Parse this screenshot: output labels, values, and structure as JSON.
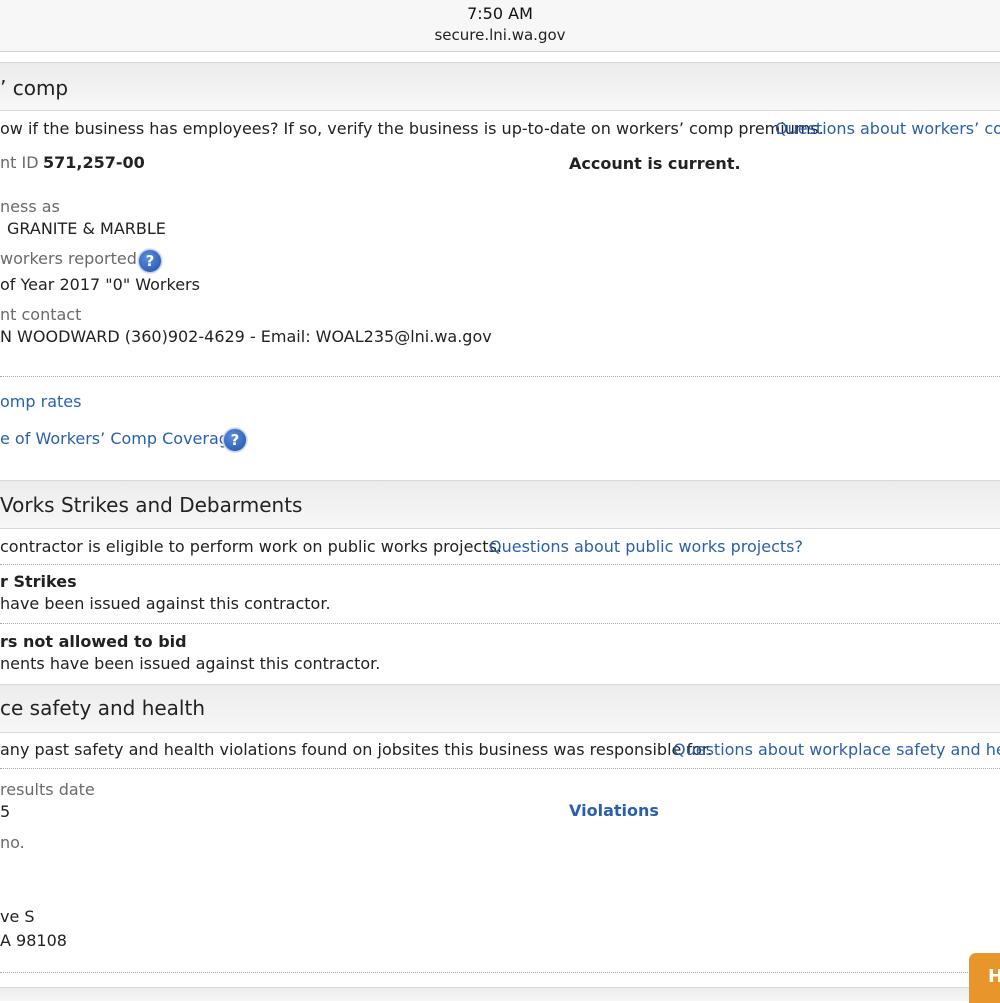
{
  "status_bar": {
    "time": "7:50 AM",
    "url": "secure.lni.wa.gov"
  },
  "workers_comp": {
    "title": "’ comp",
    "intro_text": "ow if the business has employees? If so, verify the business is up-to-date on workers’ comp premiums.",
    "intro_link": "Questions about workers’ com",
    "account_id_label": "nt ID",
    "account_id_value": "571,257-00",
    "account_status": "Account is current.",
    "dba_label": "ness as",
    "dba_value": "GRANITE & MARBLE",
    "workers_label": "workers reported",
    "workers_value": "of Year 2017 \"0\" Workers",
    "contact_label": "nt contact",
    "contact_value": "N WOODWARD (360)902-4629 - Email: WOAL235@lni.wa.gov",
    "rates_link": "omp rates",
    "coverage_link": "e of Workers’ Comp Coverage",
    "help_glyph": "?"
  },
  "public_works": {
    "title": "Vorks Strikes and Debarments",
    "intro_text": "contractor is eligible to perform work on public works projects.",
    "intro_link": "Questions about public works projects?",
    "strikes_label": "r Strikes",
    "strikes_value": "have been issued against this contractor.",
    "bid_label": "rs not allowed to bid",
    "bid_value": "nents have been issued against this contractor."
  },
  "safety": {
    "title": "ce safety and health",
    "intro_text": "any past safety and health violations found on jobsites this business was responsible for.",
    "intro_link": "Questions about workplace safety and heal",
    "date_label": "results date",
    "date_value": "5",
    "violations_link": "Violations",
    "no_label": "no.",
    "address_line1": "ve S",
    "address_line2": "A 98108"
  },
  "help_tab": {
    "label": "H"
  },
  "colors": {
    "link": "#2a5fae",
    "help_icon": "#1f4fa8",
    "tab": "#e8952b"
  }
}
